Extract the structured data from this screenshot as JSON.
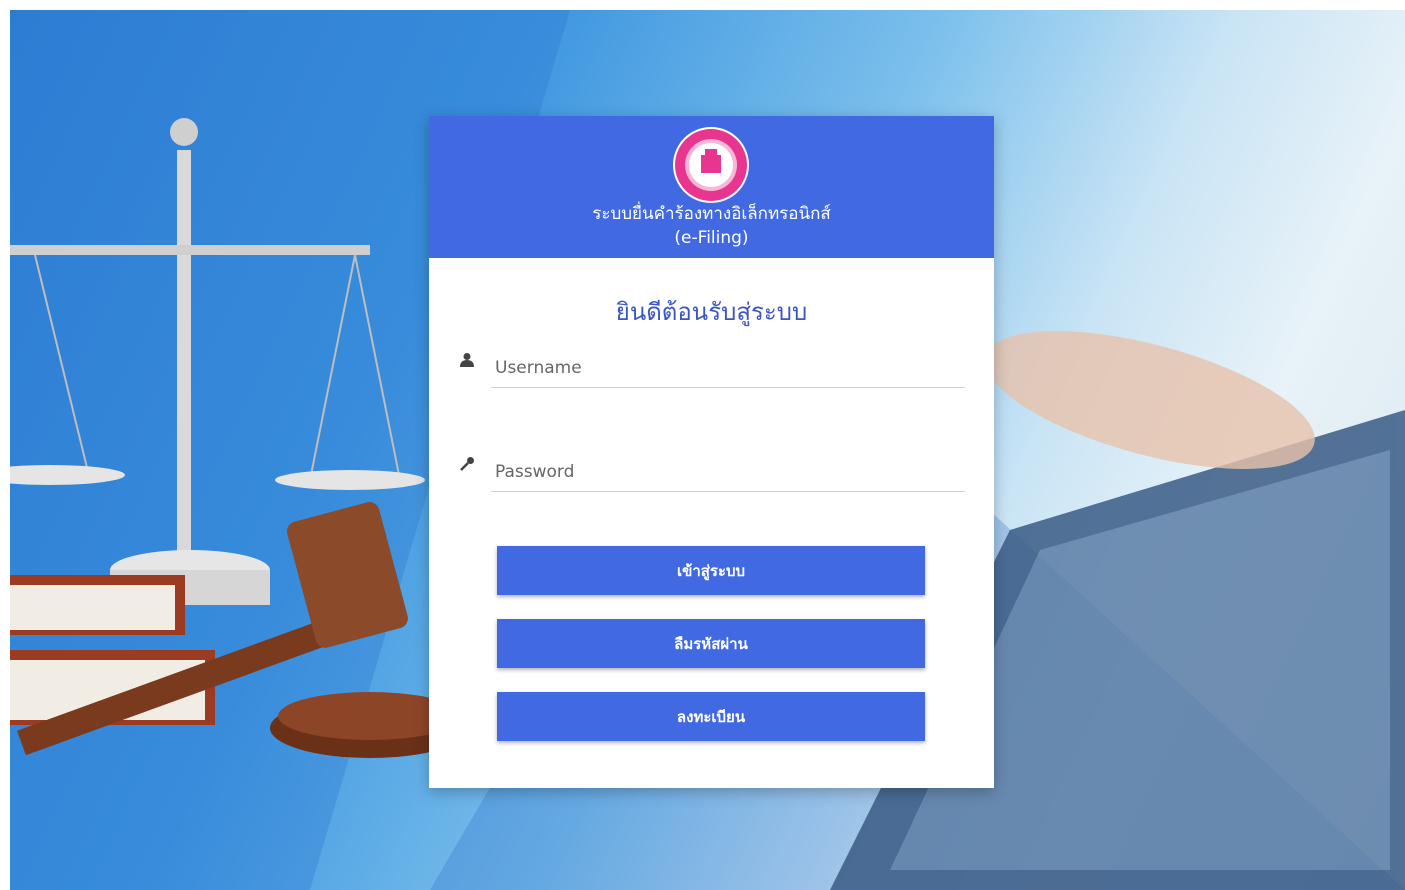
{
  "header": {
    "title_line1": "ระบบยื่นคำร้องทางอิเล็กทรอนิกส์",
    "title_line2": "(e-Filing)"
  },
  "welcome": "ยินดีต้อนรับสู่ระบบ",
  "login_form": {
    "username": {
      "value": "",
      "placeholder": "Username",
      "icon": "user-icon"
    },
    "password": {
      "value": "",
      "placeholder": "Password",
      "icon": "key-icon"
    }
  },
  "buttons": {
    "login_label": "เข้าสู่ระบบ",
    "forgot_label": "ลืมรหัสผ่าน",
    "register_label": "ลงทะเบียน"
  },
  "colors": {
    "primary": "#4169e1",
    "title_text": "#3a55c4",
    "seal": "#e8358f"
  }
}
